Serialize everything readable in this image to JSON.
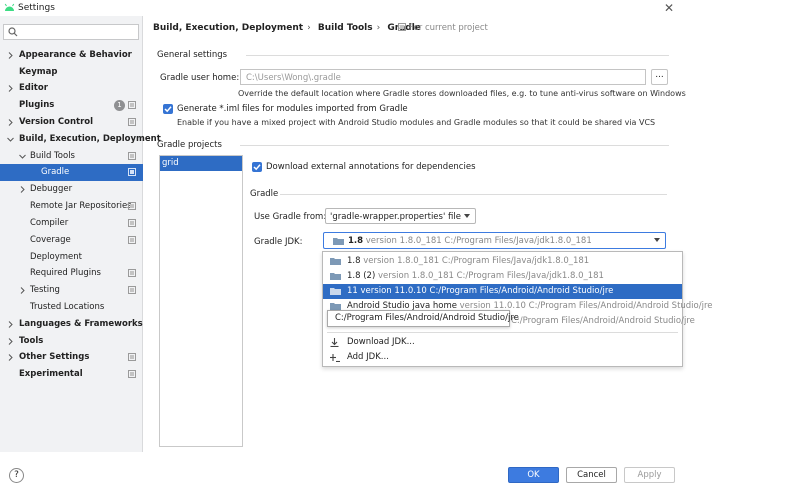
{
  "window": {
    "title": "Settings"
  },
  "search": {
    "placeholder": ""
  },
  "sidebar": {
    "items": [
      {
        "label": "Appearance & Behavior"
      },
      {
        "label": "Keymap"
      },
      {
        "label": "Editor"
      },
      {
        "label": "Plugins",
        "badge": "1"
      },
      {
        "label": "Version Control"
      },
      {
        "label": "Build, Execution, Deployment"
      },
      {
        "label": "Build Tools"
      },
      {
        "label": "Gradle"
      },
      {
        "label": "Debugger"
      },
      {
        "label": "Remote Jar Repositories"
      },
      {
        "label": "Compiler"
      },
      {
        "label": "Coverage"
      },
      {
        "label": "Deployment"
      },
      {
        "label": "Required Plugins"
      },
      {
        "label": "Testing"
      },
      {
        "label": "Trusted Locations"
      },
      {
        "label": "Languages & Frameworks"
      },
      {
        "label": "Tools"
      },
      {
        "label": "Other Settings"
      },
      {
        "label": "Experimental"
      }
    ]
  },
  "breadcrumb": {
    "parts": [
      "Build, Execution, Deployment",
      "Build Tools",
      "Gradle"
    ],
    "separator": "›",
    "for_current": "For current project"
  },
  "general": {
    "title": "General settings",
    "user_home_label": "Gradle user home:",
    "user_home_value": "C:\\Users\\Wong\\.gradle",
    "browse_label": "...",
    "user_home_hint": "Override the default location where Gradle stores downloaded files, e.g. to tune anti-virus software on Windows",
    "iml_label": "Generate *.iml files for modules imported from Gradle",
    "iml_hint": "Enable if you have a mixed project with Android Studio modules and Gradle modules so that it could be shared via VCS"
  },
  "projects": {
    "title": "Gradle projects",
    "items": [
      "grid"
    ],
    "download_annotations": "Download external annotations for dependencies",
    "gradle_section": "Gradle",
    "use_from_label": "Use Gradle from:",
    "use_from_value": "'gradle-wrapper.properties' file",
    "jdk_label": "Gradle JDK:",
    "jdk_selected_name": "1.8",
    "jdk_selected_ver": "version 1.8.0_181 C:/Program Files/Java/jdk1.8.0_181"
  },
  "jdk_options": [
    {
      "name": "1.8",
      "ver": "version 1.8.0_181 C:/Program Files/Java/jdk1.8.0_181"
    },
    {
      "name": "1.8 (2)",
      "ver": "version 1.8.0_181 C:/Program Files/Java/jdk1.8.0_181"
    },
    {
      "name": "11",
      "ver": "version 11.0.10 C:/Program Files/Android/Android Studio/jre"
    },
    {
      "name": "Android Studio java home",
      "ver": "version 11.0.10 C:/Program Files/Android/Android Studio/jre"
    },
    {
      "name": "",
      "ver": "C:/Program Files/Android/Android Studio/jre"
    }
  ],
  "jdk_actions": {
    "download": "Download JDK...",
    "add": "Add JDK..."
  },
  "tooltip": "C:/Program Files/Android/Android Studio/jre",
  "buttons": {
    "ok": "OK",
    "cancel": "Cancel",
    "apply": "Apply",
    "help": "?"
  },
  "colors": {
    "accent": "#2e6cc4",
    "ok_button": "#3d7be0",
    "sidebar_bg": "#f1f2f4"
  }
}
